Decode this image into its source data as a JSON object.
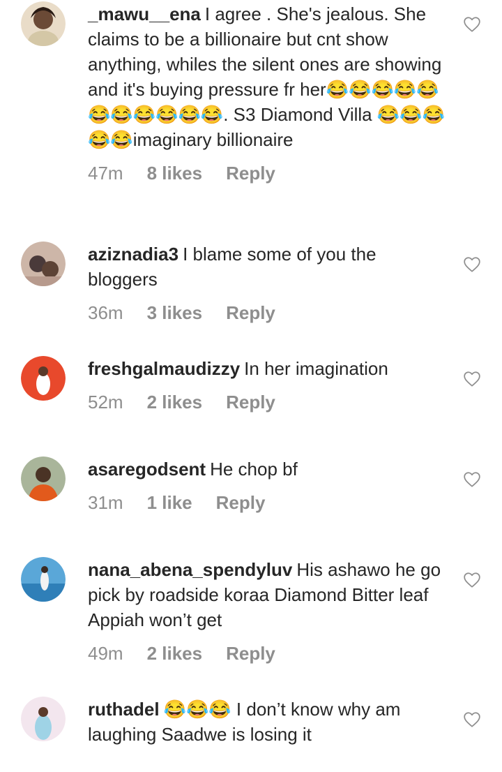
{
  "comments": [
    {
      "username": "_mawu__ena",
      "text": "I agree . She's jealous. She claims to be a billionaire but cnt show anything, whiles the silent ones are showing and it's buying pressure fr her😂😂😂😂😂😂😂😂😂😂😂. S3 Diamond Villa 😂😂😂😂😂imaginary billionaire",
      "time": "47m",
      "likes": "8 likes",
      "reply": "Reply",
      "avatar_color": "#6b4a36"
    },
    {
      "username": "aziznadia3",
      "text": "I blame some of you the bloggers",
      "time": "36m",
      "likes": "3 likes",
      "reply": "Reply",
      "avatar_color": "#4a3a3a"
    },
    {
      "username": "freshgalmaudizzy",
      "text": "In her imagination",
      "time": "52m",
      "likes": "2 likes",
      "reply": "Reply",
      "avatar_color": "#e8492c"
    },
    {
      "username": "asaregodsent",
      "text": "He chop bf",
      "time": "31m",
      "likes": "1 like",
      "reply": "Reply",
      "avatar_color": "#7a8a6a"
    },
    {
      "username": "nana_abena_spendyluv",
      "text": "His ashawo he go pick by roadside koraa Diamond Bitter leaf Appiah won’t get",
      "time": "49m",
      "likes": "2 likes",
      "reply": "Reply",
      "avatar_color": "#5aa7d8"
    },
    {
      "username": "ruthadel",
      "text": "😂😂😂 I don’t know why am laughing Saadwe is losing it",
      "time": "",
      "likes": "",
      "reply": "",
      "avatar_color": "#d9b0c4"
    }
  ],
  "icons": {
    "like": "heart-outline-icon"
  }
}
